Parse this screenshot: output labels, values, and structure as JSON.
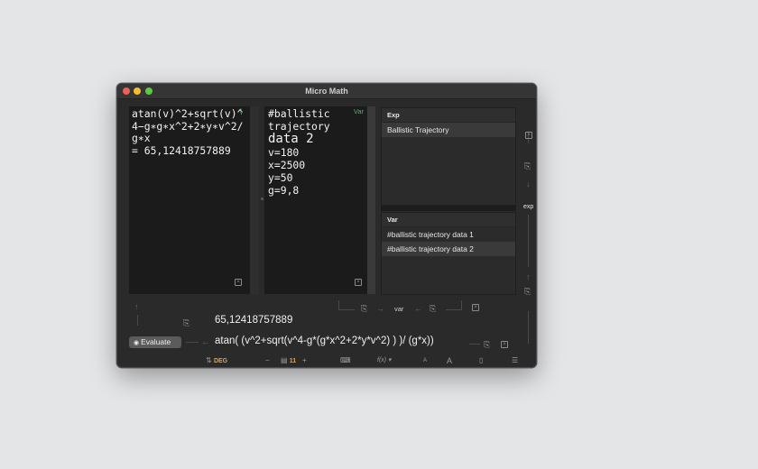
{
  "window": {
    "title": "Micro Math"
  },
  "editor": {
    "expression": "atan(v)^2+sqrt(v)^4−g∗g∗x^2+2∗y∗v^2/g∗x",
    "result": " = 65,12418757889"
  },
  "variables_pane": {
    "badge": "Var",
    "lines": [
      "#ballistic",
      "trajectory",
      "data 2",
      "v=180",
      "x=2500",
      "y=50",
      "g=9,8"
    ]
  },
  "exp_list": {
    "header": "Exp",
    "items": [
      "Ballistic Trajectory"
    ]
  },
  "var_list": {
    "header": "Var",
    "items": [
      "#ballistic trajectory data  1",
      "#ballistic trajectory data 2"
    ]
  },
  "side": {
    "exp_label": "exp"
  },
  "bottom": {
    "var_button": "var",
    "result": "65,12418757889",
    "formula": "atan(  (v^2+sqrt(v^4-g*(g*x^2+2*y*v^2) ) )/  (g*x))",
    "evaluate": "Evaluate"
  },
  "toolbar": {
    "angle_mode": "DEG",
    "font_size": "11",
    "function_menu": "f(x)",
    "font_small": "A",
    "font_large": "A"
  },
  "icons": {
    "curve": "curve-icon",
    "close": "close-icon",
    "copy": "copy-icon",
    "arrow": "arrow-icon",
    "keyboard": "keyboard-icon",
    "notes": "notes-icon",
    "list": "list-icon"
  }
}
